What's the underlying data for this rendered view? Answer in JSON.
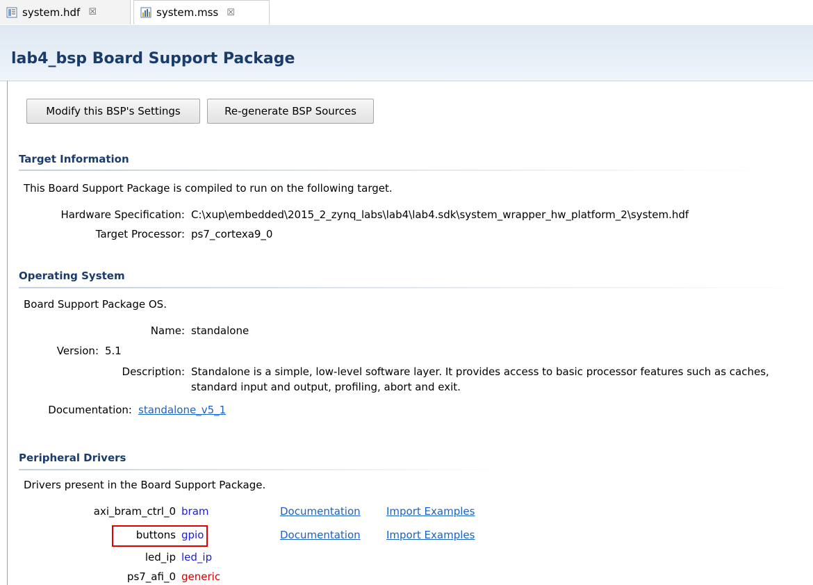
{
  "tabs": [
    {
      "label": "system.hdf",
      "icon": "hdf-file-icon",
      "close": "☒"
    },
    {
      "label": "system.mss",
      "icon": "mss-file-icon",
      "close": "☒"
    }
  ],
  "header": {
    "title": "lab4_bsp Board Support Package"
  },
  "buttons": {
    "modify": "Modify this BSP's Settings",
    "regenerate": "Re-generate BSP Sources"
  },
  "target": {
    "title": "Target Information",
    "intro": "This Board Support Package is compiled to run on the following target.",
    "hw_label": "Hardware Specification:",
    "hw_value": "C:\\xup\\embedded\\2015_2_zynq_labs\\lab4\\lab4.sdk\\system_wrapper_hw_platform_2\\system.hdf",
    "proc_label": "Target Processor:",
    "proc_value": "ps7_cortexa9_0"
  },
  "os": {
    "title": "Operating System",
    "intro": "Board Support Package OS.",
    "name_label": "Name:",
    "name_value": "standalone",
    "version_label": "Version:",
    "version_value": "5.1",
    "desc_label": "Description:",
    "desc_line1": "Standalone is a simple, low-level software layer. It provides access to basic processor features such as caches,",
    "desc_line2": "standard input and output, profiling, abort and exit.",
    "doc_label": "Documentation:",
    "doc_link": "standalone_v5_1"
  },
  "drivers": {
    "title": "Peripheral Drivers",
    "intro": "Drivers present in the Board Support Package.",
    "rows": [
      {
        "name": "axi_bram_ctrl_0",
        "driver": "bram",
        "doc": "Documentation",
        "examples": "Import Examples"
      },
      {
        "name": "buttons",
        "driver": "gpio",
        "doc": "Documentation",
        "examples": "Import Examples"
      },
      {
        "name": "led_ip",
        "driver": "led_ip"
      },
      {
        "name": "ps7_afi_0",
        "driver": "generic"
      }
    ]
  },
  "colors": {
    "title": "#1a3c6b",
    "link": "#1a62c6",
    "driver": "#1c1cd9",
    "generic": "#d40000",
    "highlight": "#e00000"
  }
}
